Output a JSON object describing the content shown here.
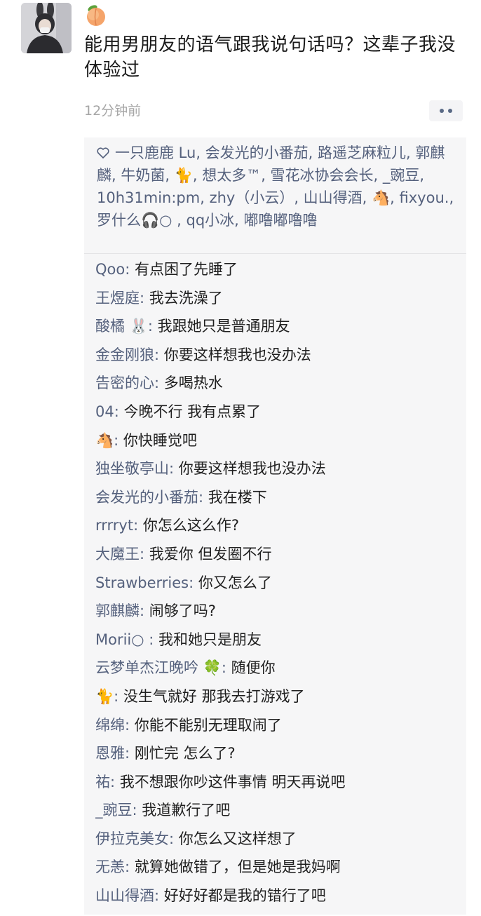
{
  "post": {
    "text": "能用男朋友的语气跟我说句话吗？这辈子我没体验过",
    "timestamp": "12分钟前",
    "emoji_icon": "peach-icon"
  },
  "likes": {
    "text": "一只鹿鹿 Lu, 会发光的小番茄, 路遥芝麻粒儿, 郭麒麟, 牛奶菌, 🐈, 想太多™, 雪花冰协会会长, _豌豆, 10h31min:pm, zhy（小云）, 山山得酒, 🐴, fixyou., 罗什么🎧○ , qq小冰, 嘟噜嘟噜噜"
  },
  "comments": [
    {
      "name": "Qoo",
      "text": "有点困了先睡了"
    },
    {
      "name": "王煜庭",
      "text": "我去洗澡了"
    },
    {
      "name": "酸橘 🐰",
      "text": "我跟她只是普通朋友"
    },
    {
      "name": "金金刚狼",
      "text": "你要这样想我也没办法"
    },
    {
      "name": "告密的心",
      "text": "多喝热水"
    },
    {
      "name": "04",
      "text": "今晚不行 我有点累了"
    },
    {
      "name": "🐴",
      "text": "你快睡觉吧"
    },
    {
      "name": "独坐敬亭山",
      "text": "你要这样想我也没办法"
    },
    {
      "name": "会发光的小番茄",
      "text": "我在楼下"
    },
    {
      "name": "rrrryt",
      "text": "你怎么这么作?"
    },
    {
      "name": "大魔王",
      "text": "我爱你  但发圈不行"
    },
    {
      "name": "Strawberries",
      "text": "你又怎么了"
    },
    {
      "name": "郭麒麟",
      "text": "闹够了吗?"
    },
    {
      "name": "Morii○ ",
      "text": "我和她只是朋友"
    },
    {
      "name": "云梦单杰江晚吟 🍀",
      "text": "随便你"
    },
    {
      "name": "🐈",
      "text": "没生气就好 那我去打游戏了"
    },
    {
      "name": "绵绵",
      "text": "你能不能别无理取闹了"
    },
    {
      "name": "恩雅",
      "text": "刚忙完 怎么了?"
    },
    {
      "name": "祐",
      "text": "我不想跟你吵这件事情 明天再说吧"
    },
    {
      "name": "_豌豆",
      "text": "我道歉行了吧"
    },
    {
      "name": "伊拉克美女",
      "text": "你怎么又这样想了"
    },
    {
      "name": "无恙",
      "text": "就算她做错了，但是她是我妈啊"
    },
    {
      "name": "山山得酒",
      "text": "好好好都是我的错行了吧"
    }
  ],
  "colors": {
    "name_blue": "#55617d",
    "panel_bg": "#f6f6f7",
    "timestamp_gray": "#a6a6a6"
  }
}
